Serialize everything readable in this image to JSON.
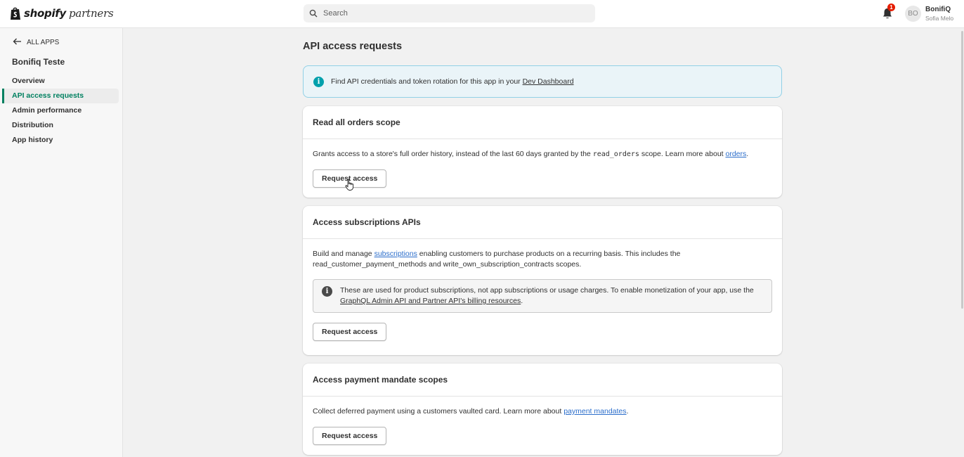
{
  "header": {
    "logo_brand": "shopify",
    "logo_sub": "partners",
    "search_placeholder": "Search",
    "notification_count": "1",
    "avatar_initials": "BO",
    "user_name": "BonifiQ",
    "user_subtitle": "Sofia Melo"
  },
  "sidebar": {
    "back_label": "ALL APPS",
    "app_name": "Bonifiq Teste",
    "items": [
      {
        "label": "Overview",
        "active": false
      },
      {
        "label": "API access requests",
        "active": true
      },
      {
        "label": "Admin performance",
        "active": false
      },
      {
        "label": "Distribution",
        "active": false
      },
      {
        "label": "App history",
        "active": false
      }
    ]
  },
  "main": {
    "title": "API access requests",
    "banner": {
      "text": "Find API credentials and token rotation for this app in your ",
      "link": "Dev Dashboard"
    },
    "cards": [
      {
        "title": "Read all orders scope",
        "desc_before": "Grants access to a store's full order history, instead of the last 60 days granted by the ",
        "desc_code": "read_orders",
        "desc_mid": " scope. Learn more about ",
        "desc_link": "orders",
        "desc_after": ".",
        "button": "Request access"
      },
      {
        "title": "Access subscriptions APIs",
        "desc_before": "Build and manage ",
        "desc_link": "subscriptions",
        "desc_after": " enabling customers to purchase products on a recurring basis. This includes the read_customer_payment_methods and write_own_subscription_contracts scopes.",
        "note_text": "These are used for product subscriptions, not app subscriptions or usage charges. To enable monetization of your app, use the ",
        "note_link": "GraphQL Admin API and Partner API's billing resources",
        "note_after": ".",
        "button": "Request access"
      },
      {
        "title": "Access payment mandate scopes",
        "desc_before": "Collect deferred payment using a customers vaulted card. Learn more about ",
        "desc_link": "payment mandates",
        "desc_after": ".",
        "button": "Request access"
      }
    ]
  },
  "colors": {
    "accent_green": "#008060",
    "banner_bg": "#eaf4f8",
    "banner_icon": "#00a0ac",
    "link_blue": "#2c6ecb",
    "badge_red": "#e51c00"
  },
  "icons": [
    "shopify-bag-icon",
    "search-icon",
    "bell-icon",
    "arrow-left-icon",
    "info-icon",
    "hand-cursor-icon"
  ]
}
